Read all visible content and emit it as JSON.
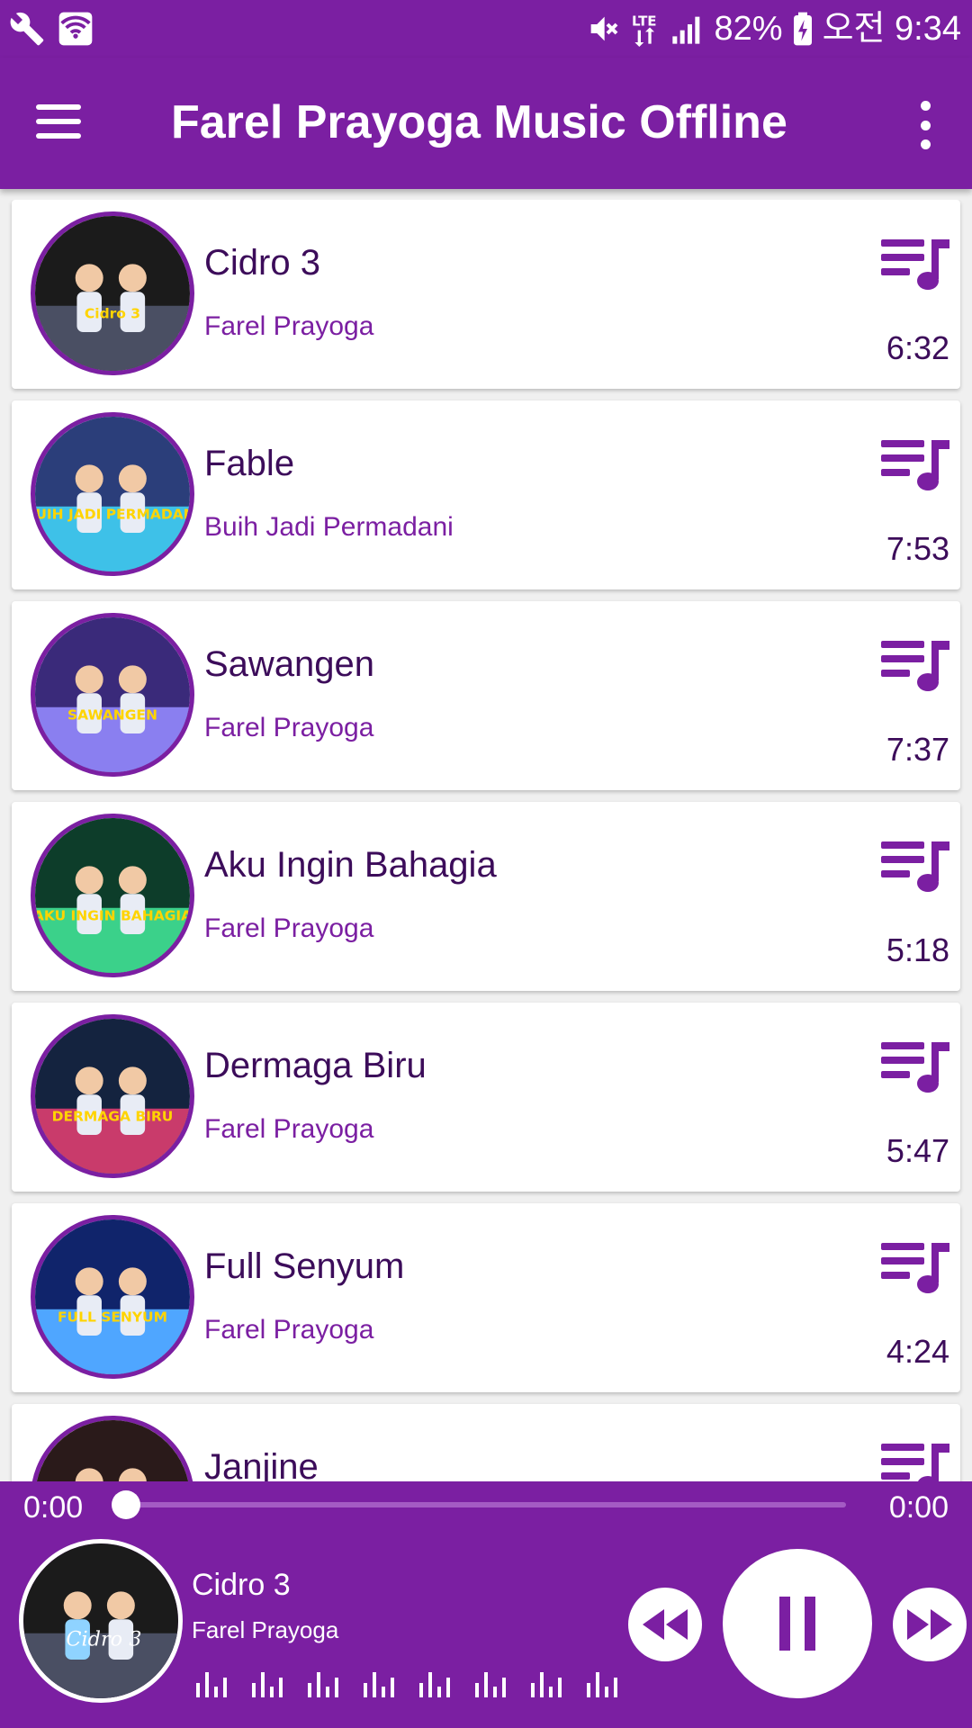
{
  "status_bar": {
    "battery": "82%",
    "time": "오전 9:34"
  },
  "app_bar": {
    "title": "Farel Prayoga Music Offline"
  },
  "songs": [
    {
      "title": "Cidro 3",
      "artist": "Farel Prayoga",
      "duration": "6:32",
      "cover_text": "Cidro 3",
      "cover_colors": [
        "#1b1b1b",
        "#4a4f63"
      ]
    },
    {
      "title": "Fable",
      "artist": "Buih Jadi Permadani",
      "duration": "7:53",
      "cover_text": "BUIH JADI PERMADANI",
      "cover_colors": [
        "#2b3e7a",
        "#3ec1e8"
      ]
    },
    {
      "title": "Sawangen",
      "artist": "Farel Prayoga",
      "duration": "7:37",
      "cover_text": "SAWANGEN",
      "cover_colors": [
        "#3a2a7a",
        "#8a7ff0"
      ]
    },
    {
      "title": "Aku Ingin Bahagia",
      "artist": "Farel Prayoga",
      "duration": "5:18",
      "cover_text": "AKU INGIN BAHAGIA",
      "cover_colors": [
        "#0d3d2a",
        "#3bd18a"
      ]
    },
    {
      "title": "Dermaga Biru",
      "artist": "Farel Prayoga",
      "duration": "5:47",
      "cover_text": "DERMAGA BIRU",
      "cover_colors": [
        "#14233f",
        "#c93b6b"
      ]
    },
    {
      "title": "Full Senyum",
      "artist": "Farel Prayoga",
      "duration": "4:24",
      "cover_text": "FULL SENYUM",
      "cover_colors": [
        "#10246b",
        "#4fa6ff"
      ]
    },
    {
      "title": "Janjine",
      "artist": "",
      "duration": "",
      "cover_text": "",
      "cover_colors": [
        "#2a1a1a",
        "#d98a7a"
      ]
    }
  ],
  "icons": {
    "queue": "queue-music-icon",
    "menu": "menu-icon",
    "more": "more-vert-icon"
  },
  "player": {
    "current_time": "0:00",
    "total_time": "0:00",
    "progress": 0,
    "title": "Cidro 3",
    "artist": "Farel Prayoga",
    "accent": "#7b1fa2"
  }
}
